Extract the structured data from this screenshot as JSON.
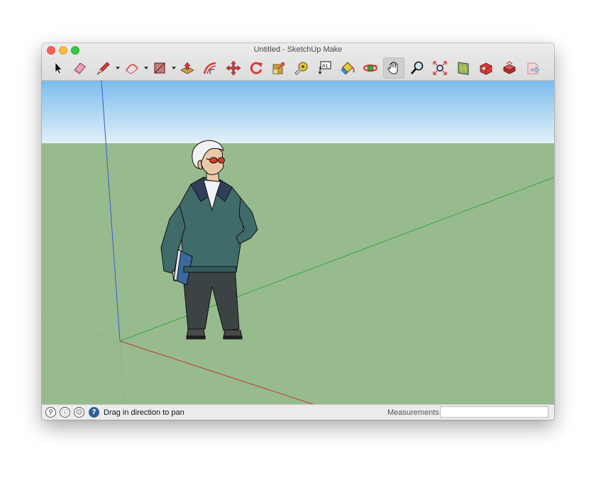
{
  "window": {
    "title": "Untitled - SketchUp Make"
  },
  "toolbar": {
    "tools": [
      {
        "name": "select",
        "icon": "arrow-cursor-icon"
      },
      {
        "name": "eraser",
        "icon": "eraser-icon"
      },
      {
        "name": "line",
        "icon": "pencil-icon",
        "has_dropdown": true
      },
      {
        "name": "arc",
        "icon": "arc-icon",
        "has_dropdown": true
      },
      {
        "name": "shapes",
        "icon": "rectangle-icon",
        "has_dropdown": true
      },
      {
        "name": "push-pull",
        "icon": "push-pull-icon"
      },
      {
        "name": "offset",
        "icon": "offset-icon"
      },
      {
        "name": "move",
        "icon": "move-icon"
      },
      {
        "name": "rotate",
        "icon": "rotate-icon"
      },
      {
        "name": "scale",
        "icon": "scale-icon"
      },
      {
        "name": "tape-measure",
        "icon": "tape-measure-icon"
      },
      {
        "name": "text",
        "icon": "text-icon"
      },
      {
        "name": "paint-bucket",
        "icon": "paint-bucket-icon"
      },
      {
        "name": "orbit",
        "icon": "orbit-icon"
      },
      {
        "name": "pan",
        "icon": "hand-icon",
        "active": true
      },
      {
        "name": "zoom",
        "icon": "magnifier-icon"
      },
      {
        "name": "zoom-extents",
        "icon": "zoom-extents-icon"
      },
      {
        "name": "section-plane",
        "icon": "section-plane-icon"
      },
      {
        "name": "3d-warehouse",
        "icon": "warehouse-icon"
      },
      {
        "name": "extension-warehouse",
        "icon": "extension-warehouse-icon"
      },
      {
        "name": "send-to-layout",
        "icon": "layout-icon"
      }
    ]
  },
  "statusbar": {
    "message": "Drag in direction to pan",
    "measurements_label": "Measurements",
    "measurements_value": ""
  },
  "colors": {
    "sky_top": "#7bbcec",
    "sky_bottom": "#e3f0f8",
    "ground": "#97bb8e",
    "axis_blue": "#3a5bd0",
    "axis_red": "#c23b2b",
    "axis_green": "#3aa640",
    "jacket": "#3f6b6a",
    "pants": "#3b4345"
  }
}
